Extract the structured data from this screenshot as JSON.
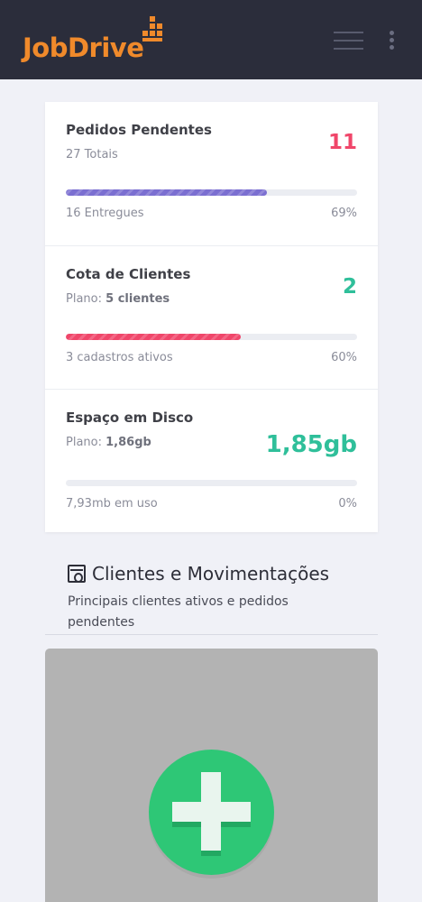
{
  "header": {
    "logo_text": "JobDrive",
    "brand_color": "#f08a2b",
    "menu_icon": "hamburger-menu-icon",
    "more_icon": "kebab-vertical-icon"
  },
  "stats": [
    {
      "title": "Pedidos Pendentes",
      "subtitle": "27 Totais",
      "value": "11",
      "value_color": "#f0466a",
      "progress_percent": 69,
      "progress_color": "#7b6fd1",
      "footer_left": "16 Entregues",
      "footer_right": "69%"
    },
    {
      "title": "Cota de Clientes",
      "subtitle_prefix": "Plano:",
      "subtitle_bold": "5 clientes",
      "value": "2",
      "value_color": "#2fbf9a",
      "progress_percent": 60,
      "progress_color": "#f0466a",
      "footer_left": "3 cadastros ativos",
      "footer_right": "60%"
    },
    {
      "title": "Espaço em Disco",
      "subtitle_prefix": "Plano:",
      "subtitle_bold": "1,86gb",
      "value": "1,85gb",
      "value_color": "#2fbf9a",
      "progress_percent": 0,
      "progress_color": "#2fbf9a",
      "footer_left": "7,93mb em uso",
      "footer_right": "0%"
    }
  ],
  "section": {
    "icon": "contact-card-icon",
    "title": "Clientes e Movimentações",
    "description": "Principais clientes ativos e pedidos pendentes"
  },
  "empty_state": {
    "icon": "plus-icon",
    "button_color": "#2ec776"
  }
}
